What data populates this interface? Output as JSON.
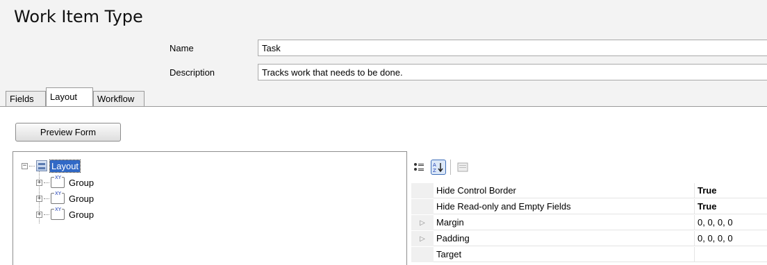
{
  "page_title": "Work Item Type",
  "fields": {
    "name_label": "Name",
    "name_value": "Task",
    "description_label": "Description",
    "description_value": "Tracks work that needs to be done."
  },
  "tabs": [
    {
      "label": "Fields",
      "active": false
    },
    {
      "label": "Layout",
      "active": true
    },
    {
      "label": "Workflow",
      "active": false
    }
  ],
  "layout_tab": {
    "preview_button": "Preview Form",
    "tree": {
      "root": {
        "label": "Layout",
        "expander": "−",
        "icon": "layout-icon"
      },
      "children": [
        {
          "label": "Group",
          "expander": "+",
          "icon": "group-icon",
          "icon_text": "XY"
        },
        {
          "label": "Group",
          "expander": "+",
          "icon": "group-icon",
          "icon_text": "XY"
        },
        {
          "label": "Group",
          "expander": "+",
          "icon": "group-icon",
          "icon_text": "XY"
        }
      ]
    },
    "property_grid": {
      "toolbar": [
        {
          "icon": "categorized-icon",
          "pressed": false
        },
        {
          "icon": "alphabetical-sort-icon",
          "pressed": true
        },
        {
          "icon": "property-pages-icon",
          "pressed": false
        }
      ],
      "rows": [
        {
          "name": "Hide Control Border",
          "value": "True",
          "bold": true,
          "expandable": false
        },
        {
          "name": "Hide Read-only and Empty Fields",
          "value": "True",
          "bold": true,
          "expandable": false
        },
        {
          "name": "Margin",
          "value": "0, 0, 0, 0",
          "bold": false,
          "expandable": true
        },
        {
          "name": "Padding",
          "value": "0, 0, 0, 0",
          "bold": false,
          "expandable": true
        },
        {
          "name": "Target",
          "value": "",
          "bold": false,
          "expandable": false
        }
      ]
    }
  }
}
